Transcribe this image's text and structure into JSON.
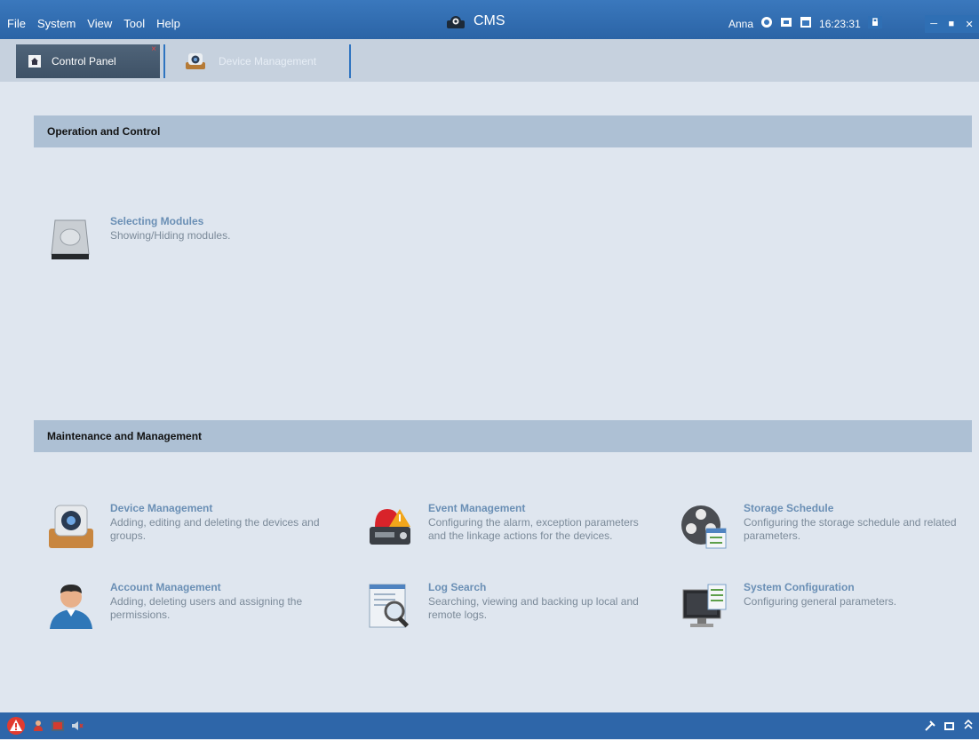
{
  "menu": [
    "File",
    "System",
    "View",
    "Tool",
    "Help"
  ],
  "app_title": "CMS",
  "status": {
    "user": "Anna",
    "time": "16:23:31"
  },
  "tabs": [
    {
      "label": "Control Panel",
      "icon": "home-icon"
    },
    {
      "label": "Device Management",
      "icon": "camera-icon"
    }
  ],
  "sections": [
    {
      "title": "Operation and Control",
      "items": [
        {
          "title": "Selecting Modules",
          "desc": "Showing/Hiding modules.",
          "icon": "hard-drive-icon"
        }
      ]
    },
    {
      "title": "Maintenance and Management",
      "items": [
        {
          "title": "Device Management",
          "desc": "Adding, editing and deleting the devices and groups.",
          "icon": "camera-box-icon"
        },
        {
          "title": "Event Management",
          "desc": "Configuring the alarm, exception parameters and the linkage actions for the devices.",
          "icon": "alarm-icon"
        },
        {
          "title": "Storage Schedule",
          "desc": "Configuring the storage schedule and related parameters.",
          "icon": "film-reel-icon"
        },
        {
          "title": "Account Management",
          "desc": "Adding, deleting users and assigning the permissions.",
          "icon": "user-icon"
        },
        {
          "title": "Log Search",
          "desc": "Searching, viewing and backing up local and remote logs.",
          "icon": "log-search-icon"
        },
        {
          "title": "System Configuration",
          "desc": "Configuring general parameters.",
          "icon": "monitor-config-icon"
        }
      ]
    }
  ]
}
